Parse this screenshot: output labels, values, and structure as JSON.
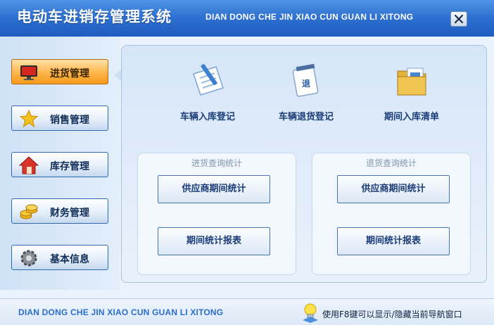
{
  "window": {
    "title": "电动车进销存管理系统",
    "subtitle": "DIAN DONG CHE JIN XIAO CUN GUAN LI XITONG",
    "close_icon": "close-icon"
  },
  "nav": {
    "items": [
      {
        "label": "进货管理",
        "icon": "monitor-icon",
        "active": true
      },
      {
        "label": "销售管理",
        "icon": "star-icon",
        "active": false
      },
      {
        "label": "库存管理",
        "icon": "house-icon",
        "active": false
      },
      {
        "label": "财务管理",
        "icon": "coins-icon",
        "active": false
      },
      {
        "label": "基本信息",
        "icon": "gear-icon",
        "active": false
      }
    ]
  },
  "tools": [
    {
      "label": "车辆入库登记",
      "icon": "document-pencil-icon"
    },
    {
      "label": "车辆退货登记",
      "icon": "calendar-icon"
    },
    {
      "label": "期间入库清单",
      "icon": "folder-icon"
    }
  ],
  "groups": [
    {
      "title": "进货查询统计",
      "buttons": [
        "供应商期间统计",
        "期间统计报表"
      ]
    },
    {
      "title": "退货查询统计",
      "buttons": [
        "供应商期间统计",
        "期间统计报表"
      ]
    }
  ],
  "footer": {
    "text": "DIAN DONG CHE JIN XIAO CUN GUAN LI XITONG",
    "hint": "使用F8键可以显示/隐藏当前导航窗口",
    "hint_icon": "lightbulb-icon"
  },
  "colors": {
    "header_blue": "#2d6fd0",
    "active_orange": "#f59a1a",
    "text_navy": "#1a3c78"
  }
}
